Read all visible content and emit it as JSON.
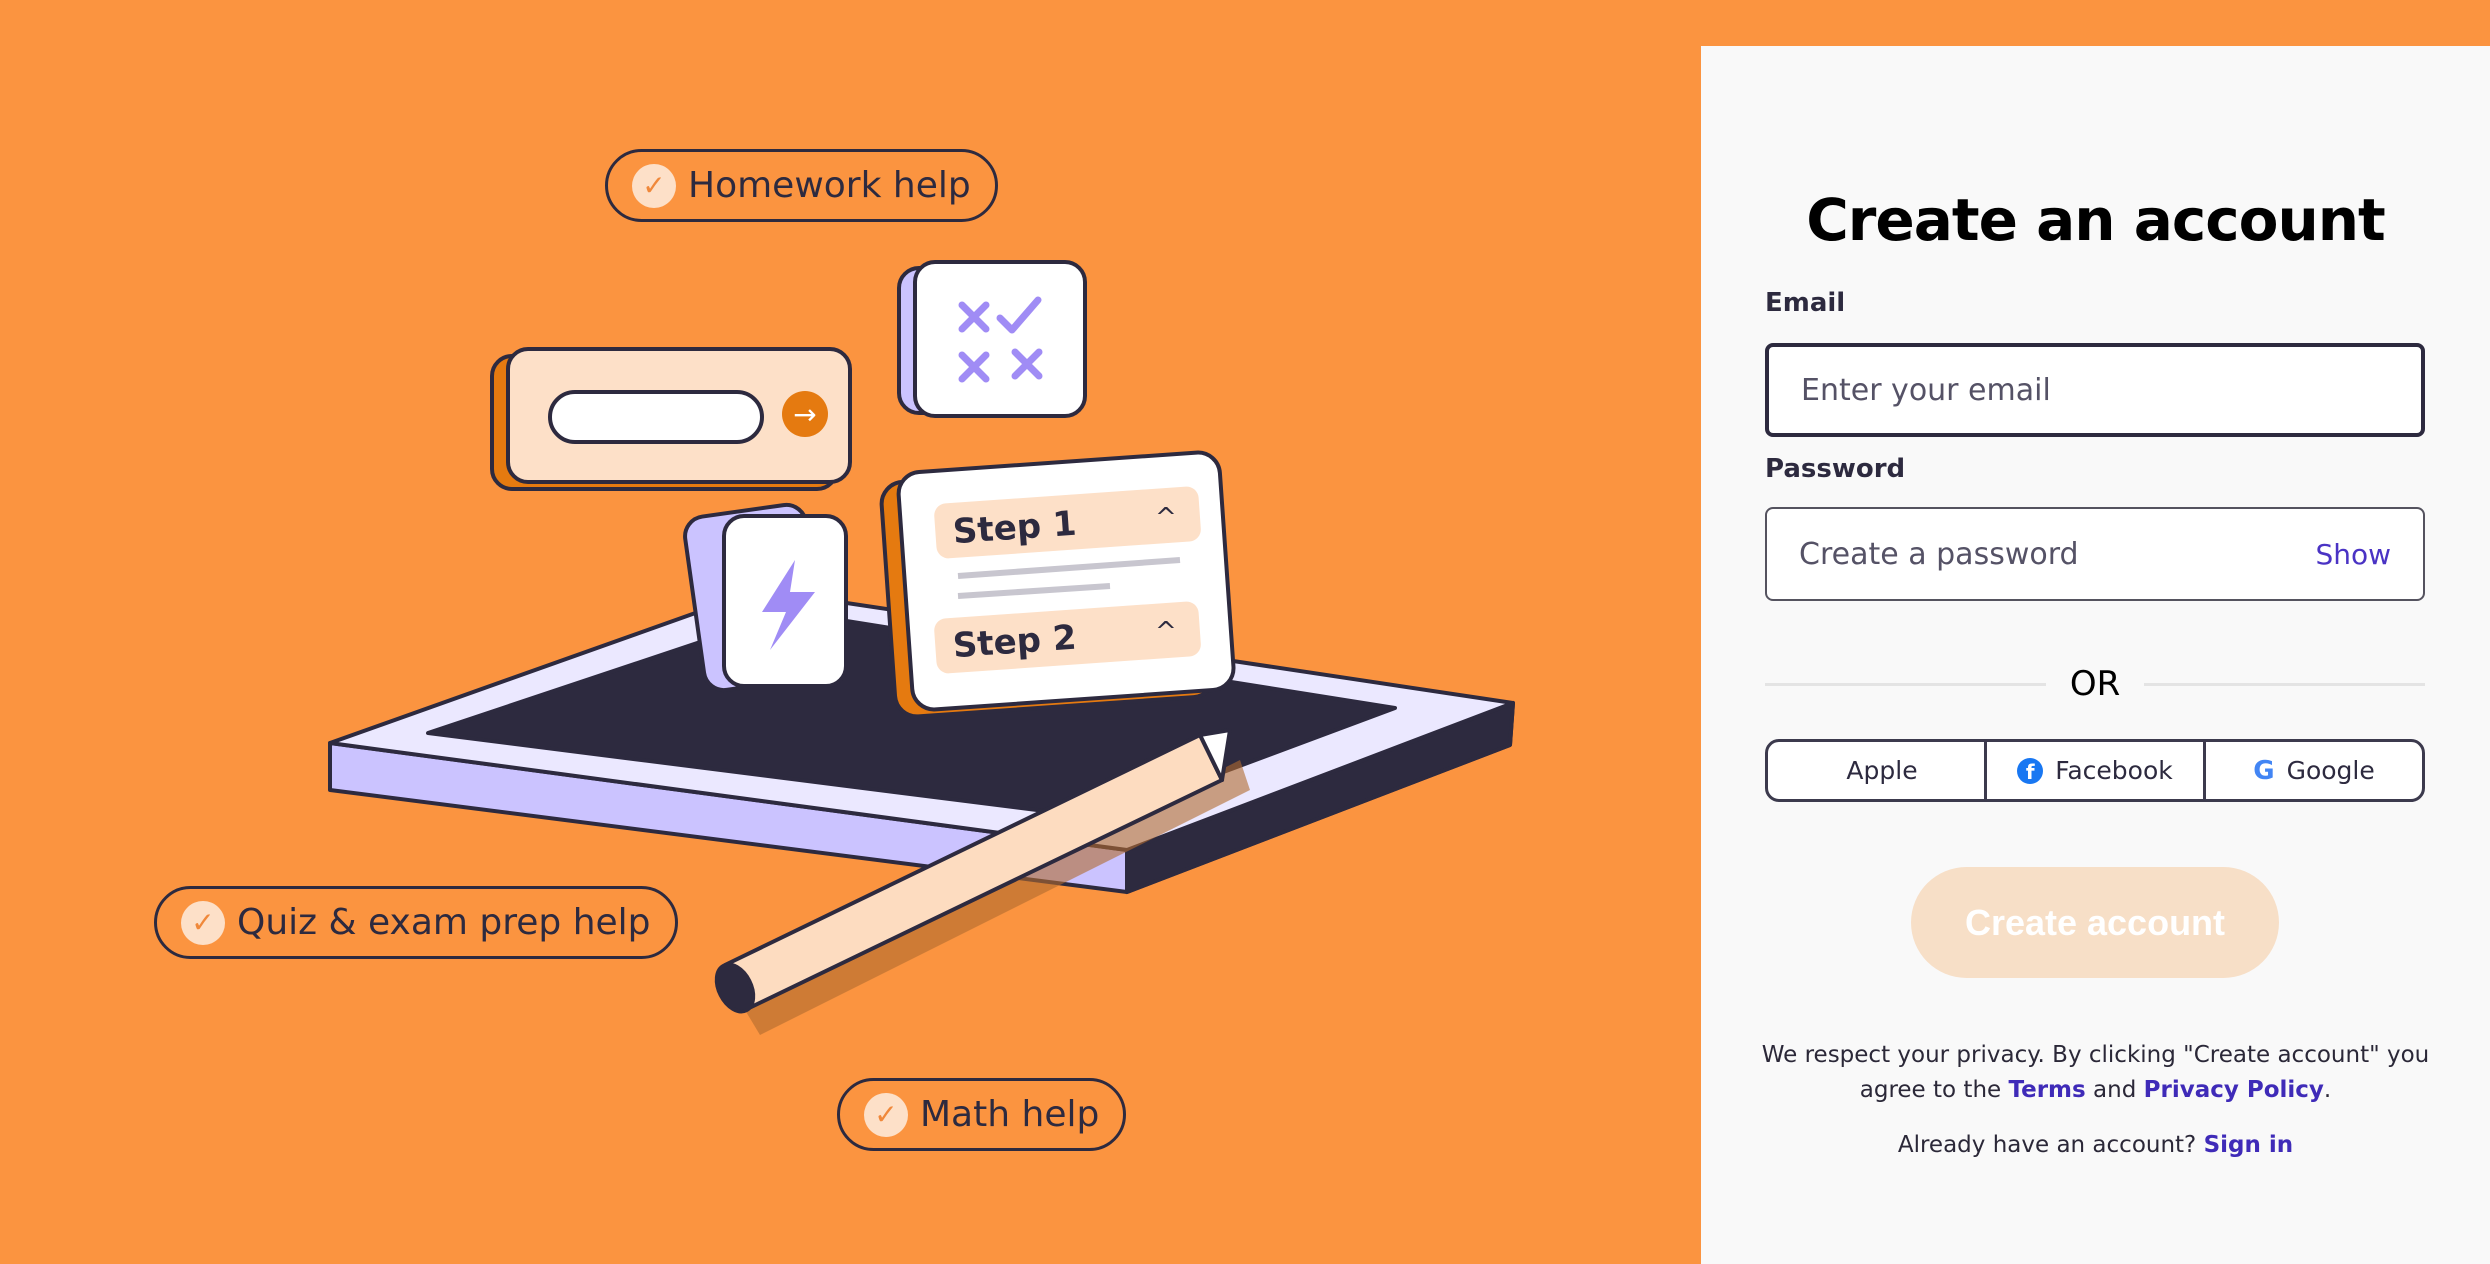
{
  "colors": {
    "background": "#fb9440",
    "panel": "#f9f9f9",
    "link": "#3f2bb8",
    "cta_disabled": "#f7dfc7",
    "dark": "#2d2a3f",
    "accent_purple": "#a08cf5"
  },
  "illustration": {
    "pills": [
      {
        "label": "Homework help",
        "icon": "check-circle-icon"
      },
      {
        "label": "Quiz & exam prep help",
        "icon": "check-circle-icon"
      },
      {
        "label": "Math help",
        "icon": "check-circle-icon"
      }
    ],
    "steps": [
      "Step 1",
      "Step 2"
    ]
  },
  "form": {
    "title": "Create an account",
    "email_label": "Email",
    "email_placeholder": "Enter your email",
    "password_label": "Password",
    "password_placeholder": "Create a password",
    "show_label": "Show",
    "or_label": "OR",
    "social": [
      {
        "label": "Apple",
        "icon": "apple-icon"
      },
      {
        "label": "Facebook",
        "icon": "facebook-icon"
      },
      {
        "label": "Google",
        "icon": "google-icon"
      }
    ],
    "submit_label": "Create account",
    "legal_prefix": "We respect your privacy. By clicking \"Create account\" you agree to the ",
    "terms_label": "Terms",
    "legal_and": " and ",
    "privacy_label": "Privacy Policy",
    "legal_suffix": ".",
    "signin_prompt": "Already have an account? ",
    "signin_label": "Sign in"
  }
}
